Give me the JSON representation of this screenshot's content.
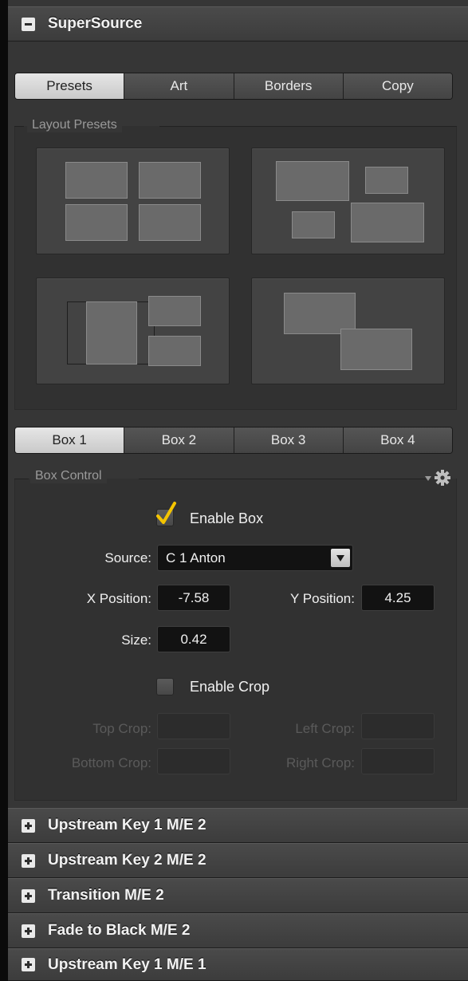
{
  "supersource": {
    "title": "SuperSource",
    "tabs": [
      {
        "label": "Presets",
        "active": true
      },
      {
        "label": "Art",
        "active": false
      },
      {
        "label": "Borders",
        "active": false
      },
      {
        "label": "Copy",
        "active": false
      }
    ],
    "layout_presets_label": "Layout Presets",
    "box_tabs": [
      {
        "label": "Box 1",
        "active": true
      },
      {
        "label": "Box 2",
        "active": false
      },
      {
        "label": "Box 3",
        "active": false
      },
      {
        "label": "Box 4",
        "active": false
      }
    ],
    "box_control": {
      "label": "Box Control",
      "enable_box": {
        "label": "Enable Box",
        "checked": true
      },
      "source": {
        "label": "Source:",
        "value": "C 1 Anton"
      },
      "x_position": {
        "label": "X Position:",
        "value": "-7.58"
      },
      "y_position": {
        "label": "Y Position:",
        "value": "4.25"
      },
      "size": {
        "label": "Size:",
        "value": "0.42"
      },
      "enable_crop": {
        "label": "Enable Crop",
        "checked": false
      },
      "top_crop": {
        "label": "Top Crop:",
        "value": ""
      },
      "left_crop": {
        "label": "Left Crop:",
        "value": ""
      },
      "bottom_crop": {
        "label": "Bottom Crop:",
        "value": ""
      },
      "right_crop": {
        "label": "Right Crop:",
        "value": ""
      }
    }
  },
  "collapsed_sections": [
    {
      "title": "Upstream Key 1 M/E 2"
    },
    {
      "title": "Upstream Key 2 M/E 2"
    },
    {
      "title": "Transition M/E 2"
    },
    {
      "title": "Fade to Black M/E 2"
    },
    {
      "title": "Upstream Key 1 M/E 1"
    }
  ],
  "colors": {
    "panel_bg": "#363636",
    "check_accent": "#f4c400",
    "active_tab": "#d8d8d8"
  }
}
